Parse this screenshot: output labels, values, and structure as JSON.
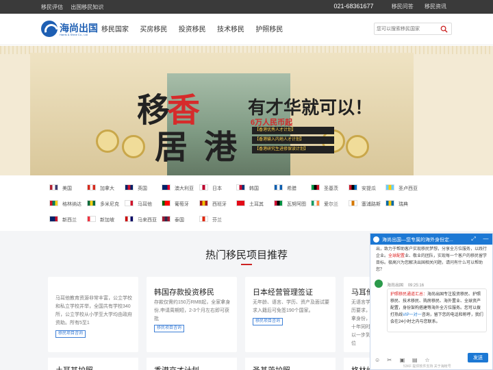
{
  "topbar": {
    "links": [
      "移民评估",
      "出国移民知识"
    ],
    "phone": "021-68361677",
    "right_links": [
      "移民问答",
      "移民资讯"
    ]
  },
  "logo": {
    "name": "海尚出国",
    "sub": "Harris & Shine Co., Ltd"
  },
  "nav": [
    "移民国家",
    "买房移民",
    "投资移民",
    "技术移民",
    "护照移民"
  ],
  "search": {
    "placeholder": "您可以搜索移民国家"
  },
  "banner": {
    "headline_a": "移",
    "headline_b": "香",
    "headline_c": "居",
    "headline_d": "港",
    "slogan": "有才华就可以！",
    "money": "6万人民币起",
    "plans": [
      "【香港优秀人才计划】",
      "【香港输入内地人才计划】",
      "【香港研究生进修保读计划】"
    ]
  },
  "countries": [
    {
      "name": "美国",
      "colors": [
        "#b22234",
        "#ffffff",
        "#3c3b6e"
      ]
    },
    {
      "name": "加拿大",
      "colors": [
        "#d52b1e",
        "#ffffff",
        "#d52b1e"
      ]
    },
    {
      "name": "英国",
      "colors": [
        "#012169",
        "#c8102e",
        "#012169"
      ]
    },
    {
      "name": "澳大利亚",
      "colors": [
        "#012169",
        "#012169",
        "#e4002b"
      ]
    },
    {
      "name": "日本",
      "colors": [
        "#ffffff",
        "#bc002d",
        "#ffffff"
      ]
    },
    {
      "name": "韩国",
      "colors": [
        "#ffffff",
        "#c60c30",
        "#003478"
      ]
    },
    {
      "name": "希腊",
      "colors": [
        "#0d5eaf",
        "#ffffff",
        "#0d5eaf"
      ]
    },
    {
      "name": "圣基茨",
      "colors": [
        "#009e49",
        "#000000",
        "#ce1126"
      ]
    },
    {
      "name": "安提瓜",
      "colors": [
        "#ce1126",
        "#000000",
        "#0072c6"
      ]
    },
    {
      "name": "圣卢西亚",
      "colors": [
        "#65cfff",
        "#ffce00",
        "#65cfff"
      ]
    },
    {
      "name": "格林纳达",
      "colors": [
        "#ce1126",
        "#007a5e",
        "#fcd116"
      ]
    },
    {
      "name": "多米尼克",
      "colors": [
        "#006b3f",
        "#fcd116",
        "#006b3f"
      ]
    },
    {
      "name": "马耳他",
      "colors": [
        "#ffffff",
        "#ffffff",
        "#cf142b"
      ]
    },
    {
      "name": "葡萄牙",
      "colors": [
        "#006600",
        "#ff0000",
        "#ff0000"
      ]
    },
    {
      "name": "西班牙",
      "colors": [
        "#aa151b",
        "#f1bf00",
        "#aa151b"
      ]
    },
    {
      "name": "土耳其",
      "colors": [
        "#e30a17",
        "#e30a17",
        "#e30a17"
      ]
    },
    {
      "name": "瓦努阿图",
      "colors": [
        "#d21034",
        "#000000",
        "#009543"
      ]
    },
    {
      "name": "爱尔兰",
      "colors": [
        "#169b62",
        "#ffffff",
        "#ff883e"
      ]
    },
    {
      "name": "塞浦路斯",
      "colors": [
        "#ffffff",
        "#d57800",
        "#ffffff"
      ]
    },
    {
      "name": "瑞典",
      "colors": [
        "#006aa7",
        "#fecc00",
        "#006aa7"
      ]
    },
    {
      "name": "新西兰",
      "colors": [
        "#012169",
        "#012169",
        "#c8102e"
      ]
    },
    {
      "name": "新加坡",
      "colors": [
        "#ef3340",
        "#ffffff",
        "#ffffff"
      ]
    },
    {
      "name": "马来西亚",
      "colors": [
        "#cc0001",
        "#ffffff",
        "#010066"
      ]
    },
    {
      "name": "泰国",
      "colors": [
        "#a51931",
        "#2d2a4a",
        "#a51931"
      ]
    },
    {
      "name": "芬兰",
      "colors": [
        "#ffffff",
        "#de2910",
        "#ffffff"
      ]
    }
  ],
  "hot": {
    "title": "热门移民项目推荐",
    "cards": [
      {
        "title": "",
        "desc": "马耳他教育资源非常丰富，公立学校和私立学校并举，全国共有学校340所，公立学校从小学至大学均由政府资助。所有5至1",
        "button": "移民项目咨询"
      },
      {
        "title": "韩国存款投资移民",
        "desc": "存款仅需约150万RMB起，全家拿身份,申请周期短，2-3个月左右即可获批",
        "button": "移民项目咨询"
      },
      {
        "title": "日本经营管理签证",
        "desc": "无年龄、语言、学历、资产及面试要求入籍后可免签190个国家。",
        "button": "移民项目咨询"
      },
      {
        "title": "马耳他",
        "desc": "无语言学历要求，拿身份，十年同时以一步到位",
        "button": ""
      }
    ],
    "cards_row2": [
      "土耳其护照",
      "香港京才计划",
      "圣基茨护照",
      "格林纳"
    ]
  },
  "chat": {
    "title": "海尚出国—您专属的海外身份定...",
    "intro_pre": "出，致力于帮助客户实现移民梦想，分享全方位服务，以践行企业。",
    "intro_red": "全球配置",
    "intro_post": "业、敬业的团队，实现每一个客户的移民留学目标。极高兴为您解决出国相关问题，请问有什么可以帮助您？",
    "agent": "海尚出国",
    "time": "09:25:16",
    "m1": "护照移民通道汇总：",
    "m2": "海尚出国专注投资移民、护照移民、技术移民、购房移民、海外置业、全球资产配置，身份架构搭建等海外全方位服务。您可以拨打热线",
    "m3": "VIP一对一",
    "m4": "咨询，留下您的电话和称呼，我们会在24小时之内与您联系。",
    "send": "发送",
    "footer": "53KF 提供软件支持  关于海帐号"
  }
}
